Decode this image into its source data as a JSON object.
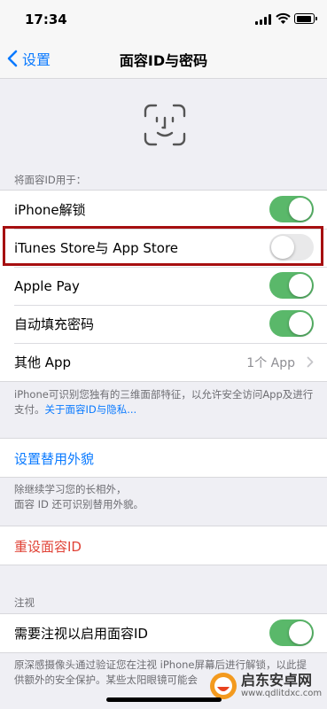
{
  "status_bar": {
    "time": "17:34",
    "icons": [
      "cellular-signal-icon",
      "wifi-icon",
      "battery-icon"
    ]
  },
  "nav": {
    "back_label": "设置",
    "title": "面容ID与密码"
  },
  "face_id_icon": "face-id-icon",
  "section_use": {
    "header": "将面容ID用于：",
    "rows": [
      {
        "label": "iPhone解锁",
        "toggle": true
      },
      {
        "label": "iTunes Store与 App Store",
        "toggle": false
      },
      {
        "label": "Apple Pay",
        "toggle": true
      },
      {
        "label": "自动填充密码",
        "toggle": true
      },
      {
        "label": "其他 App",
        "value": "1个 App"
      }
    ],
    "footer": "iPhone可识别您独有的三维面部特征，以允许安全访问App及进行支付。",
    "footer_link": "关于面容ID与隐私..."
  },
  "alt_appearance": {
    "label": "设置替用外貌",
    "footer": "除继续学习您的长相外，\n面容 ID 还可识别替用外貌。"
  },
  "reset": {
    "label": "重设面容ID"
  },
  "attention": {
    "header": "注视",
    "row_label": "需要注视以启用面容ID",
    "toggle": true,
    "footer": "原深感摄像头通过验证您在注视 iPhone屏幕后进行解锁，以此提供额外的安全保护。某些太阳眼镜可能会"
  },
  "watermark": {
    "name": "启东安卓网",
    "url": "www.qdlitdxc.com"
  },
  "colors": {
    "accent": "#0a7aff",
    "toggle_on": "#5ab86a",
    "destructive": "#e04236",
    "highlight_border": "#a60f10"
  }
}
